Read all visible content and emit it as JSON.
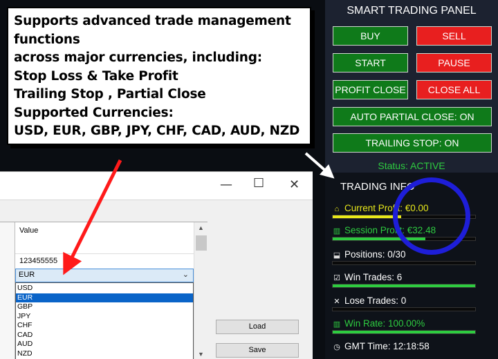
{
  "callout": {
    "lines": [
      "Supports advanced trade management",
      "functions",
      "across major currencies, including:",
      "Stop Loss & Take Profit",
      "Trailing Stop , Partial Close",
      "Supported Currencies:",
      "USD, EUR, GBP, JPY, CHF, CAD, AUD, NZD"
    ]
  },
  "window": {
    "controls": {
      "minimize": "—",
      "maximize": "☐",
      "close": "✕"
    },
    "grid": {
      "header_label": "Value",
      "row_value": "123455555",
      "combo_value": "EUR",
      "options": [
        "USD",
        "EUR",
        "GBP",
        "JPY",
        "CHF",
        "CAD",
        "AUD",
        "NZD"
      ],
      "selected": "EUR"
    },
    "buttons": {
      "load": "Load",
      "save": "Save"
    }
  },
  "panel": {
    "title": "SMART TRADING PANEL",
    "buttons": {
      "buy": "BUY",
      "sell": "SELL",
      "start": "START",
      "pause": "PAUSE",
      "profit_close": "PROFIT CLOSE",
      "close_all": "CLOSE ALL",
      "auto_partial": "AUTO PARTIAL CLOSE: ON",
      "trailing": "TRAILING STOP: ON"
    },
    "status": "Status: ACTIVE",
    "info_title": "TRADING INFO",
    "info": {
      "current_profit": "Current Profit: €0.00",
      "session_profit": "Session Profit: €32.48",
      "positions": "Positions: 0/30",
      "win_trades": "Win Trades: 6",
      "lose_trades": "Lose Trades: 0",
      "win_rate": "Win Rate: 100.00%",
      "gmt_time": "GMT Time: 12:18:58"
    },
    "levels": {
      "current_profit": 0.48,
      "session_profit": 0.65,
      "positions": 0.0,
      "win_trades": 1.0,
      "lose_trades": 0.0,
      "win_rate": 1.0
    },
    "colors": {
      "green_button": "#0f7a1a",
      "red_button": "#e81f1f",
      "status": "#2ecc40",
      "current_profit": "#e8e81a",
      "session_profit": "#2ecc40",
      "circle": "#1e1ed8",
      "arrow": "#ff1a1a"
    }
  }
}
